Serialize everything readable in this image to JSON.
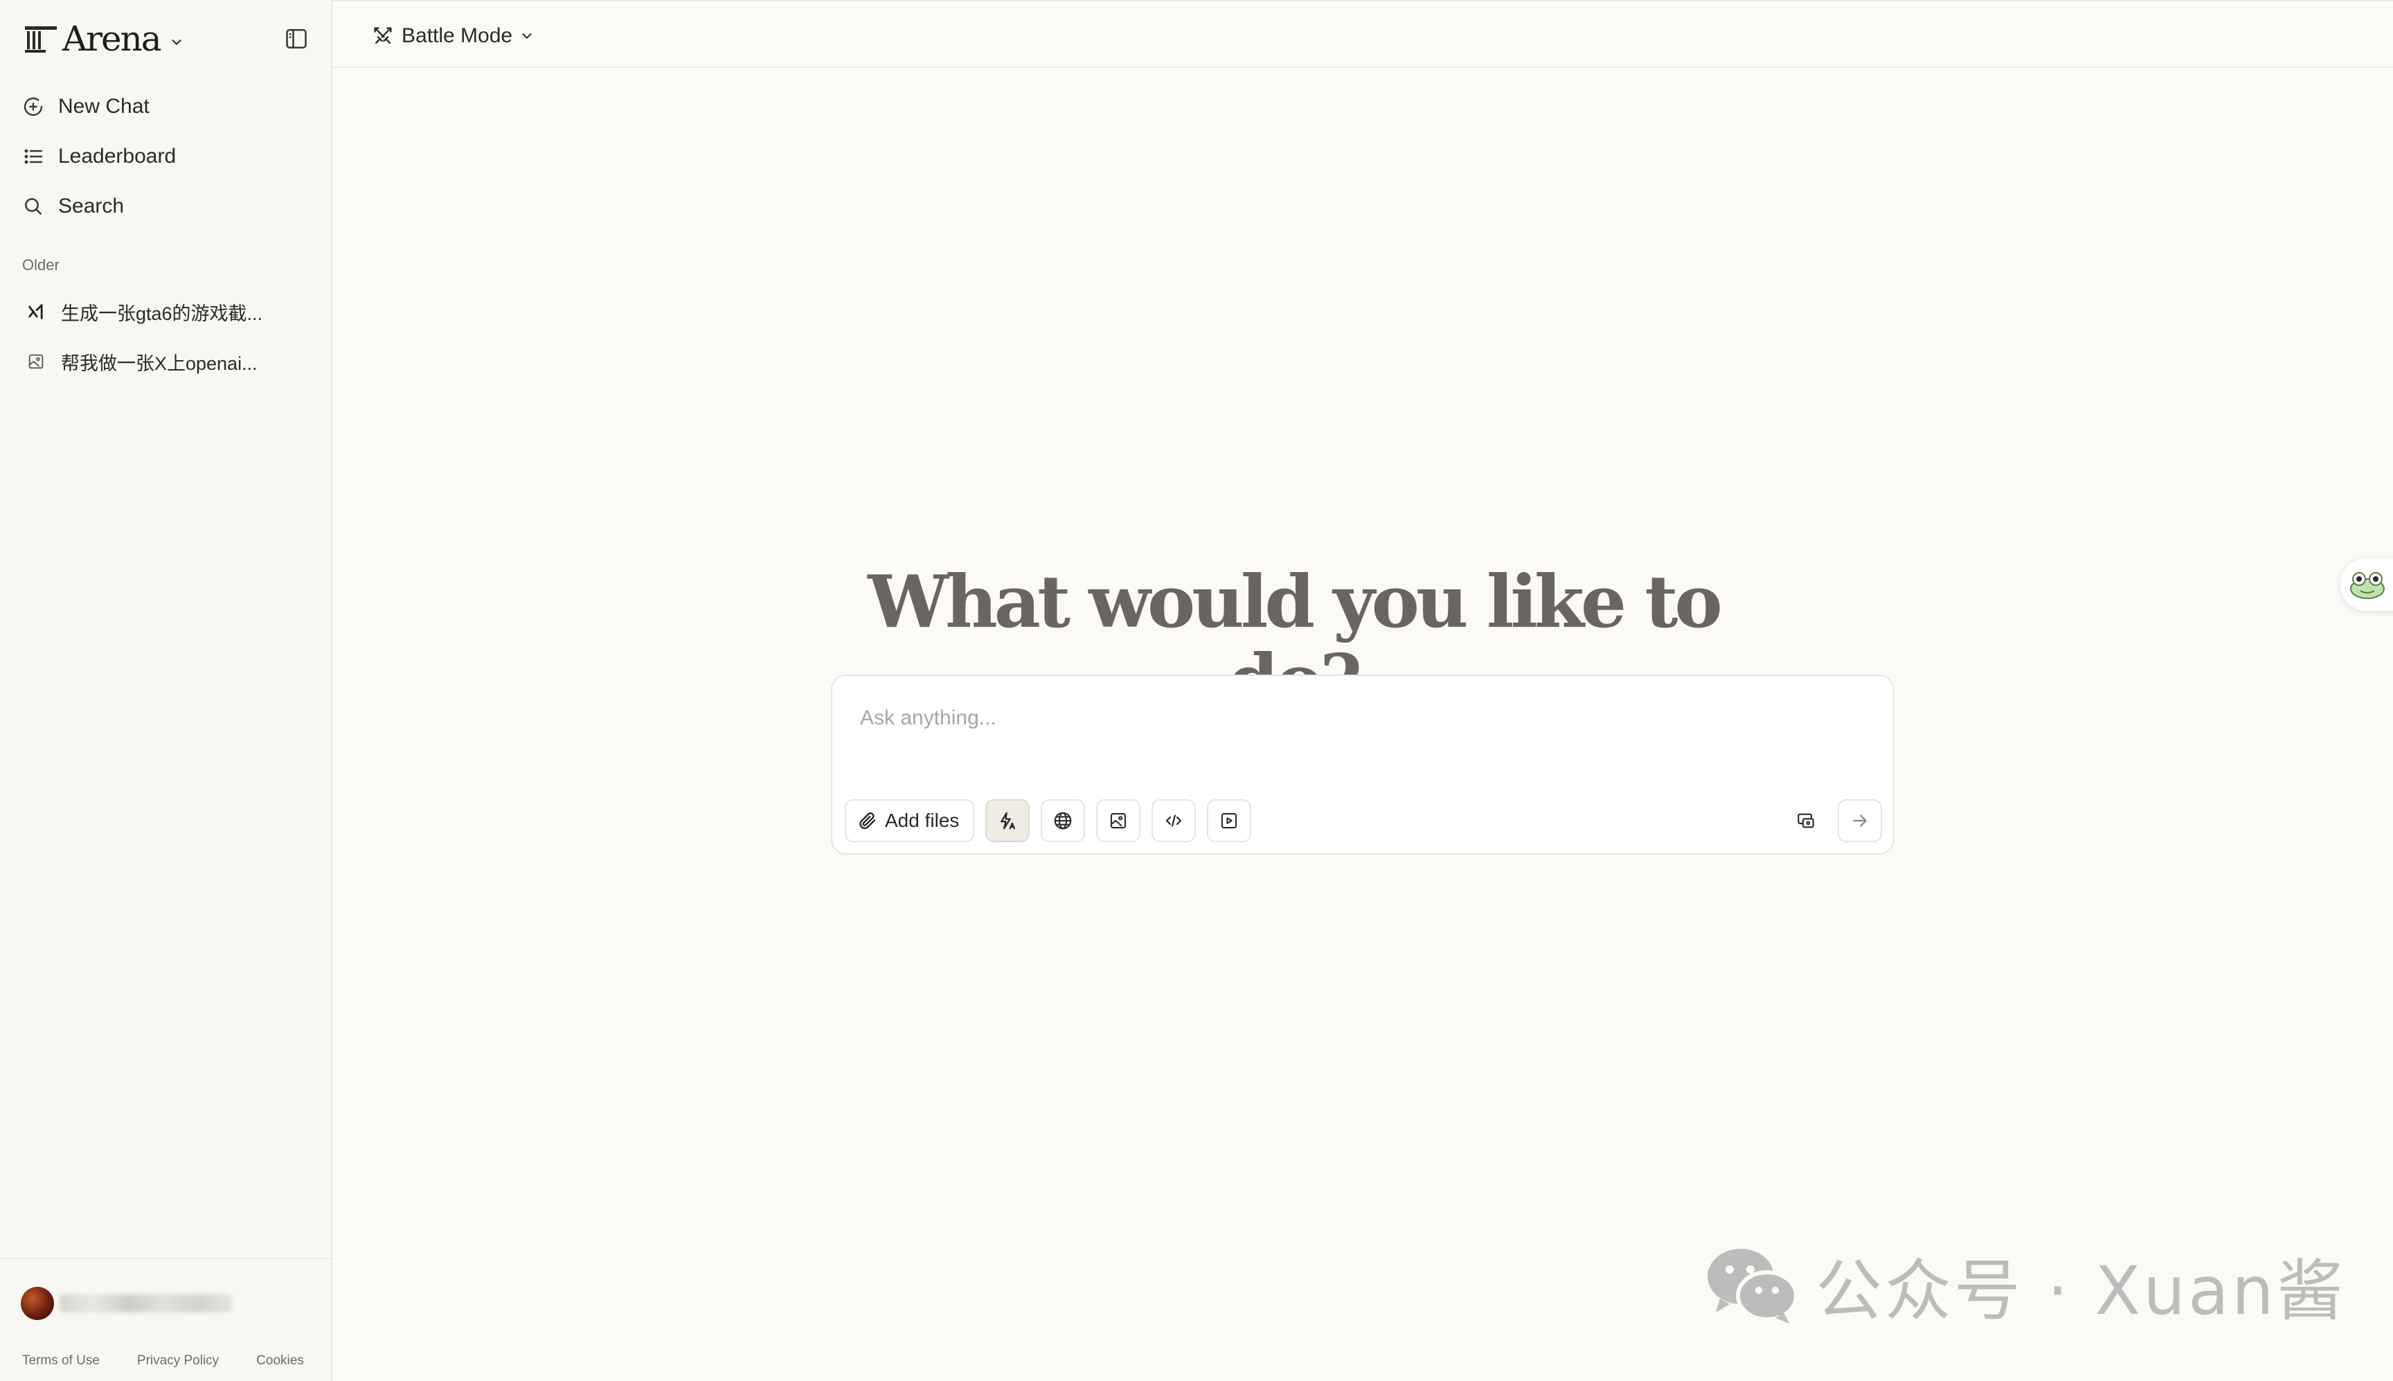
{
  "brand": {
    "name": "Arena"
  },
  "topbar": {
    "mode_label": "Battle Mode"
  },
  "nav": [
    {
      "label": "New Chat",
      "icon": "plus-circle-icon"
    },
    {
      "label": "Leaderboard",
      "icon": "list-icon"
    },
    {
      "label": "Search",
      "icon": "search-icon"
    }
  ],
  "history": {
    "section_label": "Older",
    "items": [
      {
        "label": "生成一张gta6的游戏截...",
        "icon": "x-ai-icon"
      },
      {
        "label": "帮我做一张X上openai...",
        "icon": "image-icon"
      }
    ]
  },
  "footer": {
    "terms": "Terms of Use",
    "privacy": "Privacy Policy",
    "cookies": "Cookies"
  },
  "main": {
    "headline": "What would you like to do?",
    "input_placeholder": "Ask anything...",
    "add_files_label": "Add files",
    "tools": [
      "auto-mode-icon",
      "globe-icon",
      "image-icon",
      "code-icon",
      "video-icon"
    ]
  },
  "watermark": {
    "text": "公众号 · Xuan酱"
  },
  "colors": {
    "background": "#fbfaf7",
    "sidebar": "#f8f7f4",
    "headline": "#6a6560",
    "border": "#e6e4de"
  }
}
